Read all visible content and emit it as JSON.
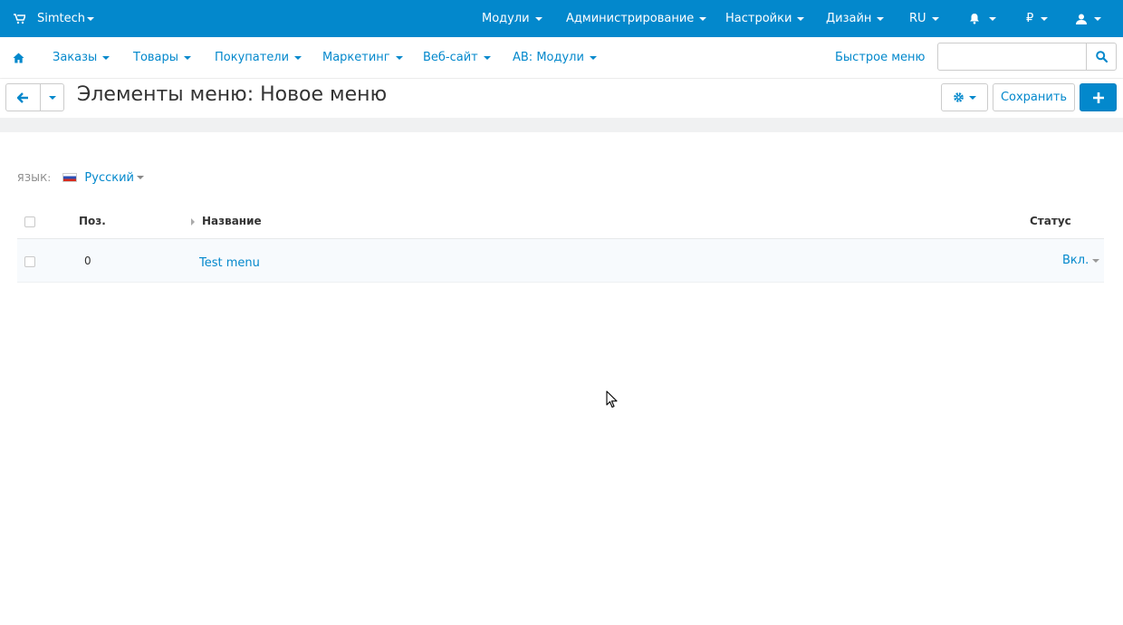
{
  "topbar": {
    "brand": "Simtech",
    "menus": [
      "Модули",
      "Администрирование",
      "Настройки",
      "Дизайн",
      "RU"
    ],
    "currency": "₽",
    "icons": {
      "cart": "cart-icon",
      "bell": "bell-icon",
      "user": "user-icon"
    }
  },
  "nav": {
    "home_icon": "home-icon",
    "items": [
      "Заказы",
      "Товары",
      "Покупатели",
      "Маркетинг",
      "Веб-сайт",
      "AB: Модули"
    ],
    "quick_menu": "Быстрое меню",
    "search_placeholder": ""
  },
  "toolbar": {
    "title": "Элементы меню: Новое меню",
    "save_label": "Сохранить"
  },
  "language": {
    "label": "ЯЗЫК:",
    "value": "Русский"
  },
  "table": {
    "headers": {
      "position": "Поз.",
      "name": "Название",
      "status": "Статус"
    },
    "rows": [
      {
        "position": "0",
        "name": "Test menu",
        "status": "Вкл."
      }
    ]
  },
  "colors": {
    "accent": "#0388cc",
    "background": "#ffffff",
    "row_bg": "#f7fafd"
  }
}
